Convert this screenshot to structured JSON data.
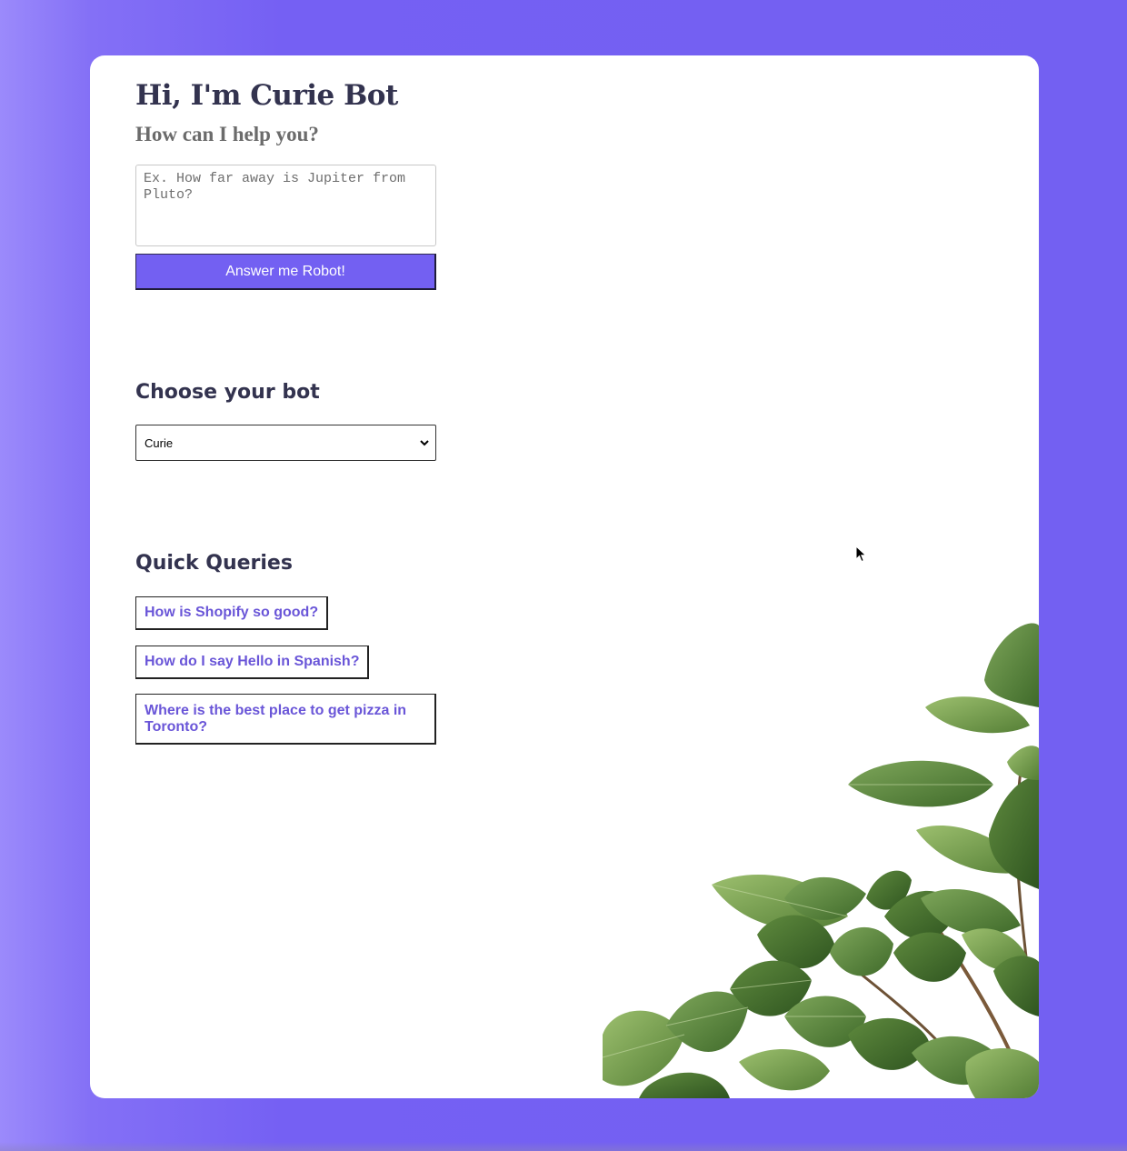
{
  "header": {
    "title": "Hi, I'm Curie Bot",
    "subtitle": "How can I help you?"
  },
  "query": {
    "placeholder": "Ex. How far away is Jupiter from Pluto?",
    "value": "",
    "submit_label": "Answer me Robot!"
  },
  "bot_selector": {
    "heading": "Choose your bot",
    "selected": "Curie"
  },
  "quick_queries": {
    "heading": "Quick Queries",
    "items": [
      "How is Shopify so good?",
      "How do I say Hello in Spanish?",
      "Where is the best place to get pizza in Toronto?"
    ]
  },
  "theme": {
    "accent": "#7360f2",
    "heading_color": "#33334f",
    "link_color": "#6a56d8"
  },
  "decoration": {
    "image": "plant-leaves-illustration",
    "cursor": "mouse-pointer-icon"
  }
}
